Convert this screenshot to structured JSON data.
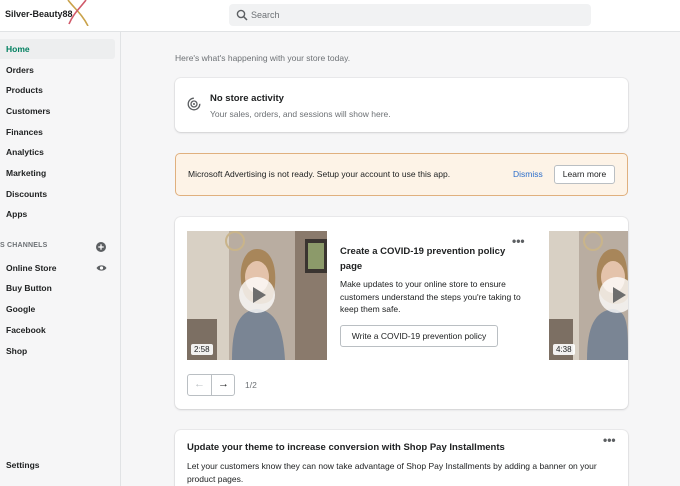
{
  "header": {
    "store_name": "Silver-Beauty88",
    "search_placeholder": "Search"
  },
  "sidebar": {
    "items": [
      {
        "label": "Home",
        "active": true
      },
      {
        "label": "Orders"
      },
      {
        "label": "Products"
      },
      {
        "label": "Customers"
      },
      {
        "label": "Finances"
      },
      {
        "label": "Analytics"
      },
      {
        "label": "Marketing"
      },
      {
        "label": "Discounts"
      },
      {
        "label": "Apps"
      }
    ],
    "channels_heading": "S CHANNELS",
    "channels": [
      {
        "label": "Online Store"
      },
      {
        "label": "Buy Button"
      },
      {
        "label": "Google"
      },
      {
        "label": "Facebook"
      },
      {
        "label": "Shop"
      }
    ],
    "settings_label": "Settings"
  },
  "main": {
    "greeting": "Here's what's happening with your store today.",
    "activity": {
      "title": "No store activity",
      "subtitle": "Your sales, orders, and sessions will show here."
    },
    "banner": {
      "text": "Microsoft Advertising is not ready. Setup your account to use this app.",
      "dismiss": "Dismiss",
      "learn_more": "Learn more",
      "bg_color": "#fdf3e7",
      "border_color": "#e0b07e"
    },
    "carousel": {
      "videos": [
        {
          "duration": "2:58"
        },
        {
          "duration": "4:38"
        }
      ],
      "tip": {
        "title": "Create a COVID-19 prevention policy page",
        "body": "Make updates to your online store to ensure customers understand the steps you're taking to keep them safe.",
        "button": "Write a COVID-19 prevention policy"
      },
      "pager": {
        "prev": "←",
        "next": "→",
        "count": "1/2"
      }
    },
    "theme": {
      "title": "Update your theme to increase conversion with Shop Pay Installments",
      "body": "Let your customers know they can now take advantage of Shop Pay Installments by adding a banner on your product pages."
    },
    "more_glyph": "•••"
  },
  "colors": {
    "active_nav": "#007f5f",
    "link": "#2c6ecb"
  }
}
